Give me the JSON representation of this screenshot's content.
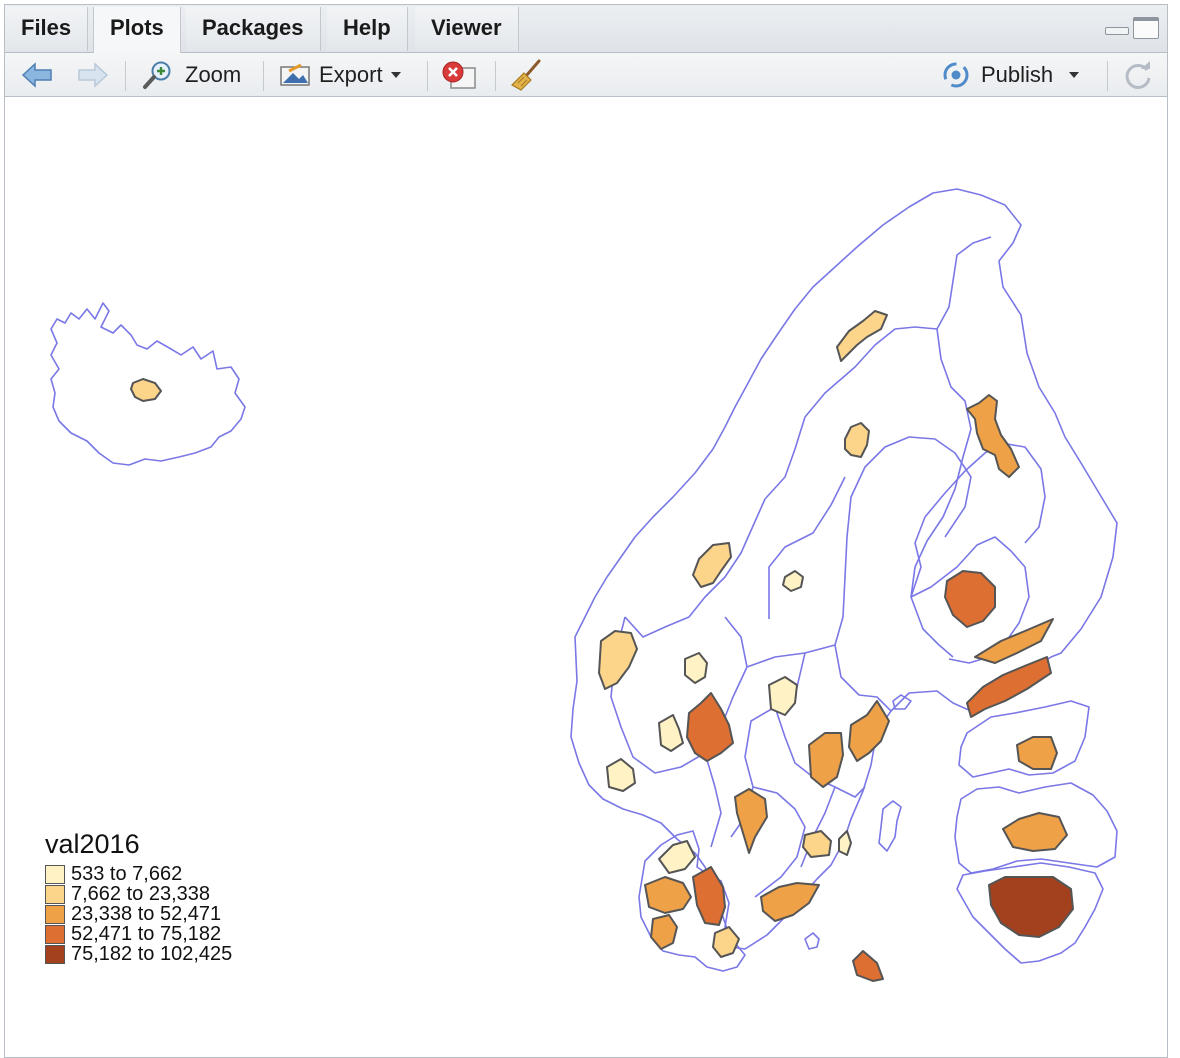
{
  "tabs": [
    {
      "label": "Files",
      "active": false
    },
    {
      "label": "Plots",
      "active": true
    },
    {
      "label": "Packages",
      "active": false
    },
    {
      "label": "Help",
      "active": false
    },
    {
      "label": "Viewer",
      "active": false
    }
  ],
  "toolbar": {
    "zoom_label": "Zoom",
    "export_label": "Export",
    "publish_label": "Publish"
  },
  "icons": {
    "back": "back-arrow-icon",
    "forward": "forward-arrow-icon",
    "zoom": "magnifier-icon",
    "export": "export-image-icon",
    "remove": "remove-plot-icon",
    "clear": "broom-icon",
    "publish": "publish-icon",
    "refresh": "refresh-icon"
  },
  "colors": {
    "outline": "#7a77e6",
    "region_border": "#555555",
    "class_1": "#fff3c6",
    "class_2": "#fcd58b",
    "class_3": "#efa148",
    "class_4": "#dd6f33",
    "class_5": "#a3411f"
  },
  "legend": {
    "title": "val2016",
    "items": [
      {
        "label": "533 to 7,662",
        "color": "#fff3c6"
      },
      {
        "label": "7,662 to 23,338",
        "color": "#fcd58b"
      },
      {
        "label": "23,338 to 52,471",
        "color": "#efa148"
      },
      {
        "label": "52,471 to 75,182",
        "color": "#dd6f33"
      },
      {
        "label": "75,182 to 102,425",
        "color": "#a3411f"
      }
    ]
  }
}
